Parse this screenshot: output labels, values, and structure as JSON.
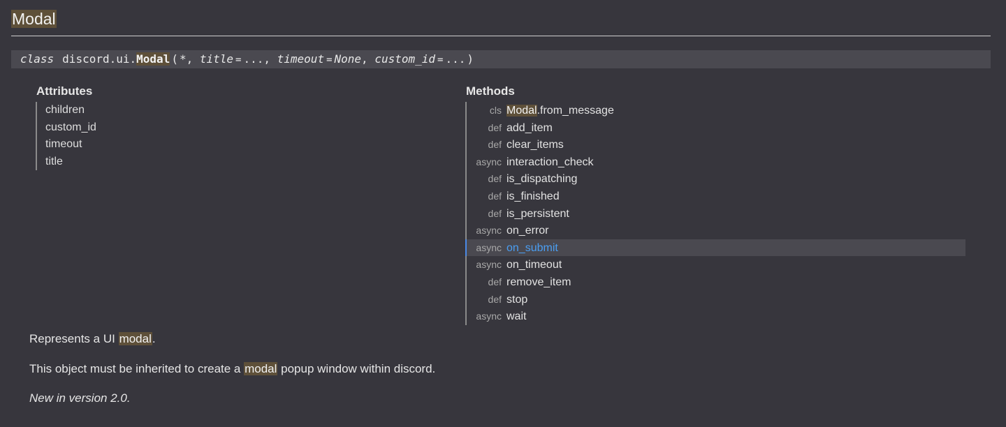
{
  "section": {
    "title": "Modal"
  },
  "signature": {
    "keyword": "class",
    "module": "discord.ui.",
    "class_name": "Modal",
    "open_paren": "(",
    "star": "*,",
    "param1_name": "title",
    "param1_eq": "=",
    "param1_val": "...,",
    "param2_name": "timeout",
    "param2_eq": "=",
    "param2_val": "None",
    "param2_comma": ",",
    "param3_name": "custom_id",
    "param3_eq": "=",
    "param3_val": "...",
    "close_paren": ")"
  },
  "attributes": {
    "heading": "Attributes",
    "items": [
      "children",
      "custom_id",
      "timeout",
      "title"
    ]
  },
  "methods": {
    "heading": "Methods",
    "items": [
      {
        "kind": "cls",
        "name_prefix": "Modal",
        "name": ".from_message"
      },
      {
        "kind": "def",
        "name": "add_item"
      },
      {
        "kind": "def",
        "name": "clear_items"
      },
      {
        "kind": "async",
        "name": "interaction_check"
      },
      {
        "kind": "def",
        "name": "is_dispatching"
      },
      {
        "kind": "def",
        "name": "is_finished"
      },
      {
        "kind": "def",
        "name": "is_persistent"
      },
      {
        "kind": "async",
        "name": "on_error"
      },
      {
        "kind": "async",
        "name": "on_submit"
      },
      {
        "kind": "async",
        "name": "on_timeout"
      },
      {
        "kind": "def",
        "name": "remove_item"
      },
      {
        "kind": "def",
        "name": "stop"
      },
      {
        "kind": "async",
        "name": "wait"
      }
    ],
    "active_index": 8
  },
  "description": {
    "line1_before": "Represents a UI ",
    "line1_highlight": "modal",
    "line1_after": ".",
    "line2_before": "This object must be inherited to create a ",
    "line2_highlight": "modal",
    "line2_after": " popup window within discord.",
    "line3": "New in version 2.0."
  },
  "colors": {
    "background": "#37363d",
    "highlight": "#5e5039",
    "active_link": "#4a9ef2",
    "active_bar": "#4a8ae8"
  }
}
